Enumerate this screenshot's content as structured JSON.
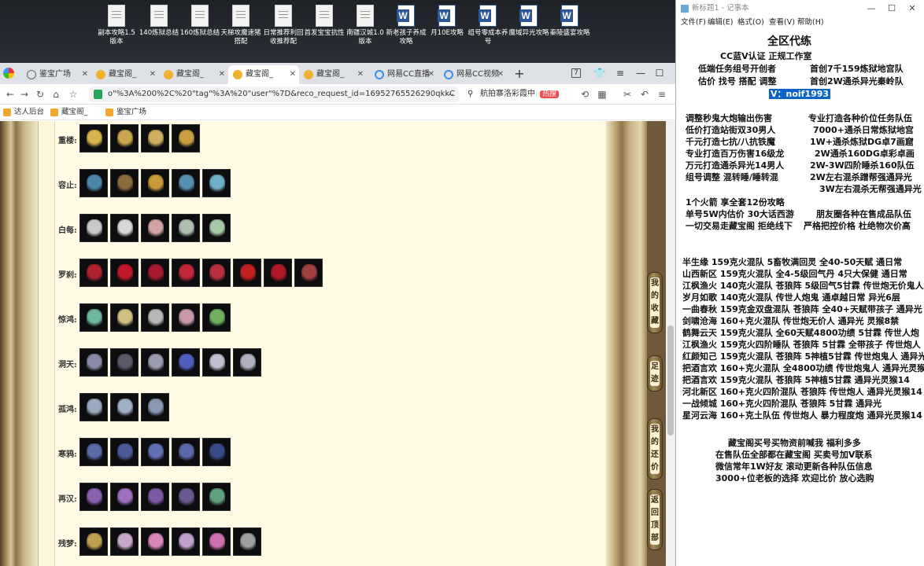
{
  "desktop": {
    "icons": [
      {
        "label": "副本攻略1.5版本",
        "type": "doc"
      },
      {
        "label": "140炼狱总结",
        "type": "doc"
      },
      {
        "label": "160炼狱总结",
        "type": "doc"
      },
      {
        "label": "天梯攻魔速猪搭配",
        "type": "doc"
      },
      {
        "label": "日常推荐利回收推荐配",
        "type": "doc"
      },
      {
        "label": "首发宝宝抗性",
        "type": "doc"
      },
      {
        "label": "南疆汉城1.0版本",
        "type": "doc"
      },
      {
        "label": "新老孩子养成攻略",
        "type": "word"
      },
      {
        "label": "月10E攻略",
        "type": "word"
      },
      {
        "label": "组号零成本养号",
        "type": "word"
      },
      {
        "label": "魔域异光攻略",
        "type": "word"
      },
      {
        "label": "秦陵盛宴攻略",
        "type": "word"
      }
    ]
  },
  "browser": {
    "tabs": [
      {
        "label": "鉴宝广场",
        "active": false
      },
      {
        "label": "藏宝阁_",
        "active": false
      },
      {
        "label": "藏宝阁_",
        "active": false
      },
      {
        "label": "藏宝阁_",
        "active": true
      },
      {
        "label": "藏宝阁_",
        "active": false
      },
      {
        "label": "网易CC直播",
        "active": false
      },
      {
        "label": "网易CC视频",
        "active": false
      }
    ],
    "tab_count": "7",
    "url": "o\"%3A%200%2C%20\"tag\"%3A%20\"user\"%7D&reco_request_id=16952765526290qkkC",
    "search_placeholder": "航拍寨洛彩霞中",
    "search_hot": "热搜",
    "bookmarks": [
      "达人后台",
      "藏宝阁_",
      "鉴宝广场"
    ]
  },
  "page": {
    "rows": [
      {
        "label": "重楼:",
        "count": 4,
        "colors": [
          "#d8b24a",
          "#c9a64c",
          "#d0b060",
          "#c8a040"
        ]
      },
      {
        "label": "容止:",
        "count": 5,
        "colors": [
          "#4a86a8",
          "#8a6d3a",
          "#c99a3a",
          "#5a8db0",
          "#6fb0c8"
        ]
      },
      {
        "label": "白每:",
        "count": 5,
        "colors": [
          "#c9c9c9",
          "#d8d8d8",
          "#d4a4a4",
          "#b0c0b0",
          "#a8c8a8"
        ]
      },
      {
        "label": "罗刹:",
        "count": 8,
        "colors": [
          "#b02030",
          "#c01828",
          "#a81830",
          "#c02838",
          "#b83040",
          "#c02020",
          "#b01828",
          "#a04040"
        ]
      },
      {
        "label": "惊鸿:",
        "count": 5,
        "colors": [
          "#6fb8a0",
          "#d0c080",
          "#b8b8b8",
          "#c898a8",
          "#70b060"
        ]
      },
      {
        "label": "洞天:",
        "count": 6,
        "colors": [
          "#8a8aa8",
          "#5a5a6a",
          "#9a9ab0",
          "#5060c0",
          "#c0c0d0",
          "#b0b0c0"
        ]
      },
      {
        "label": "孤鸿:",
        "count": 3,
        "colors": [
          "#9aa8c0",
          "#a0b0c8",
          "#8898b0"
        ]
      },
      {
        "label": "寒鸦:",
        "count": 5,
        "colors": [
          "#5a6aa8",
          "#4a5a98",
          "#6070b0",
          "#5868a8",
          "#3a4a88"
        ]
      },
      {
        "label": "再汉:",
        "count": 5,
        "colors": [
          "#8a60b0",
          "#a070c0",
          "#7a5aa0",
          "#6a5a90",
          "#60a080"
        ]
      },
      {
        "label": "残梦:",
        "count": 6,
        "colors": [
          "#c0a050",
          "#c8a8c8",
          "#d888b8",
          "#c0a0c8",
          "#d070b0",
          "#a0a0a0"
        ]
      }
    ],
    "side_buttons": [
      {
        "label": "我的收藏"
      },
      {
        "label": "足迹"
      },
      {
        "label": "我的还价"
      },
      {
        "label": "返回顶部"
      }
    ]
  },
  "notepad": {
    "title": "新标题1 - 记事本",
    "menu": [
      "文件(F)",
      "编辑(E)",
      "格式(O)",
      "查看(V)",
      "帮助(H)"
    ],
    "lines": [
      "全区代练",
      "CC蓝V认证 正规工作室",
      "低端任务组号开创者",
      "首创7千159炼狱地宫队",
      "估价 找号 搭配 调整",
      "首创2W通杀异光秦岭队",
      "V：noif1993",
      "调整秒鬼大炮输出伤害",
      "专业打造各种价位任务队伍",
      "低价打造站街双30男人",
      "7000+通杀日常炼狱地宫",
      "千元打造七抗/八抗铁魔",
      "1W+通杀炼狱DG卓7画窟",
      "专业打造百万伤害16级龙",
      "2W通杀160DG卓彩卓画",
      "万元打造通杀异光14男人",
      "2W-3W四阶睡杀160队伍",
      "组号调整 混转睡/睡转混",
      "2W左右混杀蹭帮强通异光",
      "3W左右混杀无帮强通异光",
      "1个火箭 享全套12份攻略",
      "单号5W内估价 30大话西游",
      "朋友圈各种在售成品队伍",
      "一切交易走藏宝阁 拒绝线下",
      "严格把控价格 杜绝物次价高",
      "半生缘   159克火混队 5畜牧满回灵 全40-50天赋 通日常",
      "山西新区 159克火混队 全4-5级回气丹 4只大保健 通日常",
      "江枫渔火 140克火混队 苍狼阵 5级回气5甘霖 传世炮无价鬼人",
      "岁月如歌 140克火混队 传世人炮鬼 通卓越日常 异光6层",
      "一曲春秋 159克金双盘混队 苍狼阵 全40+天赋带孩子 通异光",
      "剑啸沧海 160+克火混队 传世炮无价人 通异光 灵猴8禁",
      "鹤舞云天 159克火混队 全60天赋4800功绩 5甘霖 传世人炮",
      "江枫渔火 159克火四阶睡队 苍狼阵 5甘霖 全带孩子 传世炮人",
      "红颜知己 159克火混队 苍狼阵 5神植5甘霖 传世炮鬼人 通异光",
      "把酒言欢 160+克火混队 全4800功绩 传世炮鬼人 通异光灵猴",
      "把酒言欢 159克火混队 苍狼阵 5神植5甘霖 通异光灵猴14",
      "河北新区 160+克火四阶混队 苍狼阵 传世炮人 通异光灵猴14",
      "一战倾城 160+克火四阶混队 苍狼阵 5甘霖 通异光",
      "星河云海 160+克土队伍 传世炮人 暴力程度炮 通异光灵猴14",
      "藏宝阁买号买物资前喊我 福利多多",
      "在售队伍全部都在藏宝阁 买卖号加V联系",
      "微信常年1W好友 滚动更新各种队伍信息",
      "3000+位老板的选择 欢迎比价 放心选购"
    ]
  }
}
